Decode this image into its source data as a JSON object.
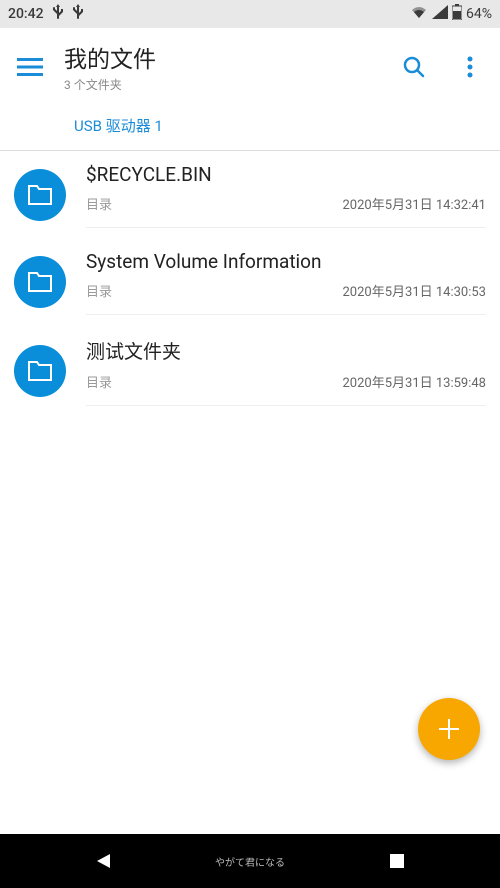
{
  "status": {
    "time": "20:42",
    "battery": "64%"
  },
  "header": {
    "title": "我的文件",
    "subtitle": "3 个文件夹"
  },
  "breadcrumb": {
    "current": "USB 驱动器 1"
  },
  "files": [
    {
      "name": "$RECYCLE.BIN",
      "type": "目录",
      "date": "2020年5月31日 14:32:41"
    },
    {
      "name": "System Volume Information",
      "type": "目录",
      "date": "2020年5月31日 14:30:53"
    },
    {
      "name": "测试文件夹",
      "type": "目录",
      "date": "2020年5月31日 13:59:48"
    }
  ],
  "navHome": "やがて君になる"
}
